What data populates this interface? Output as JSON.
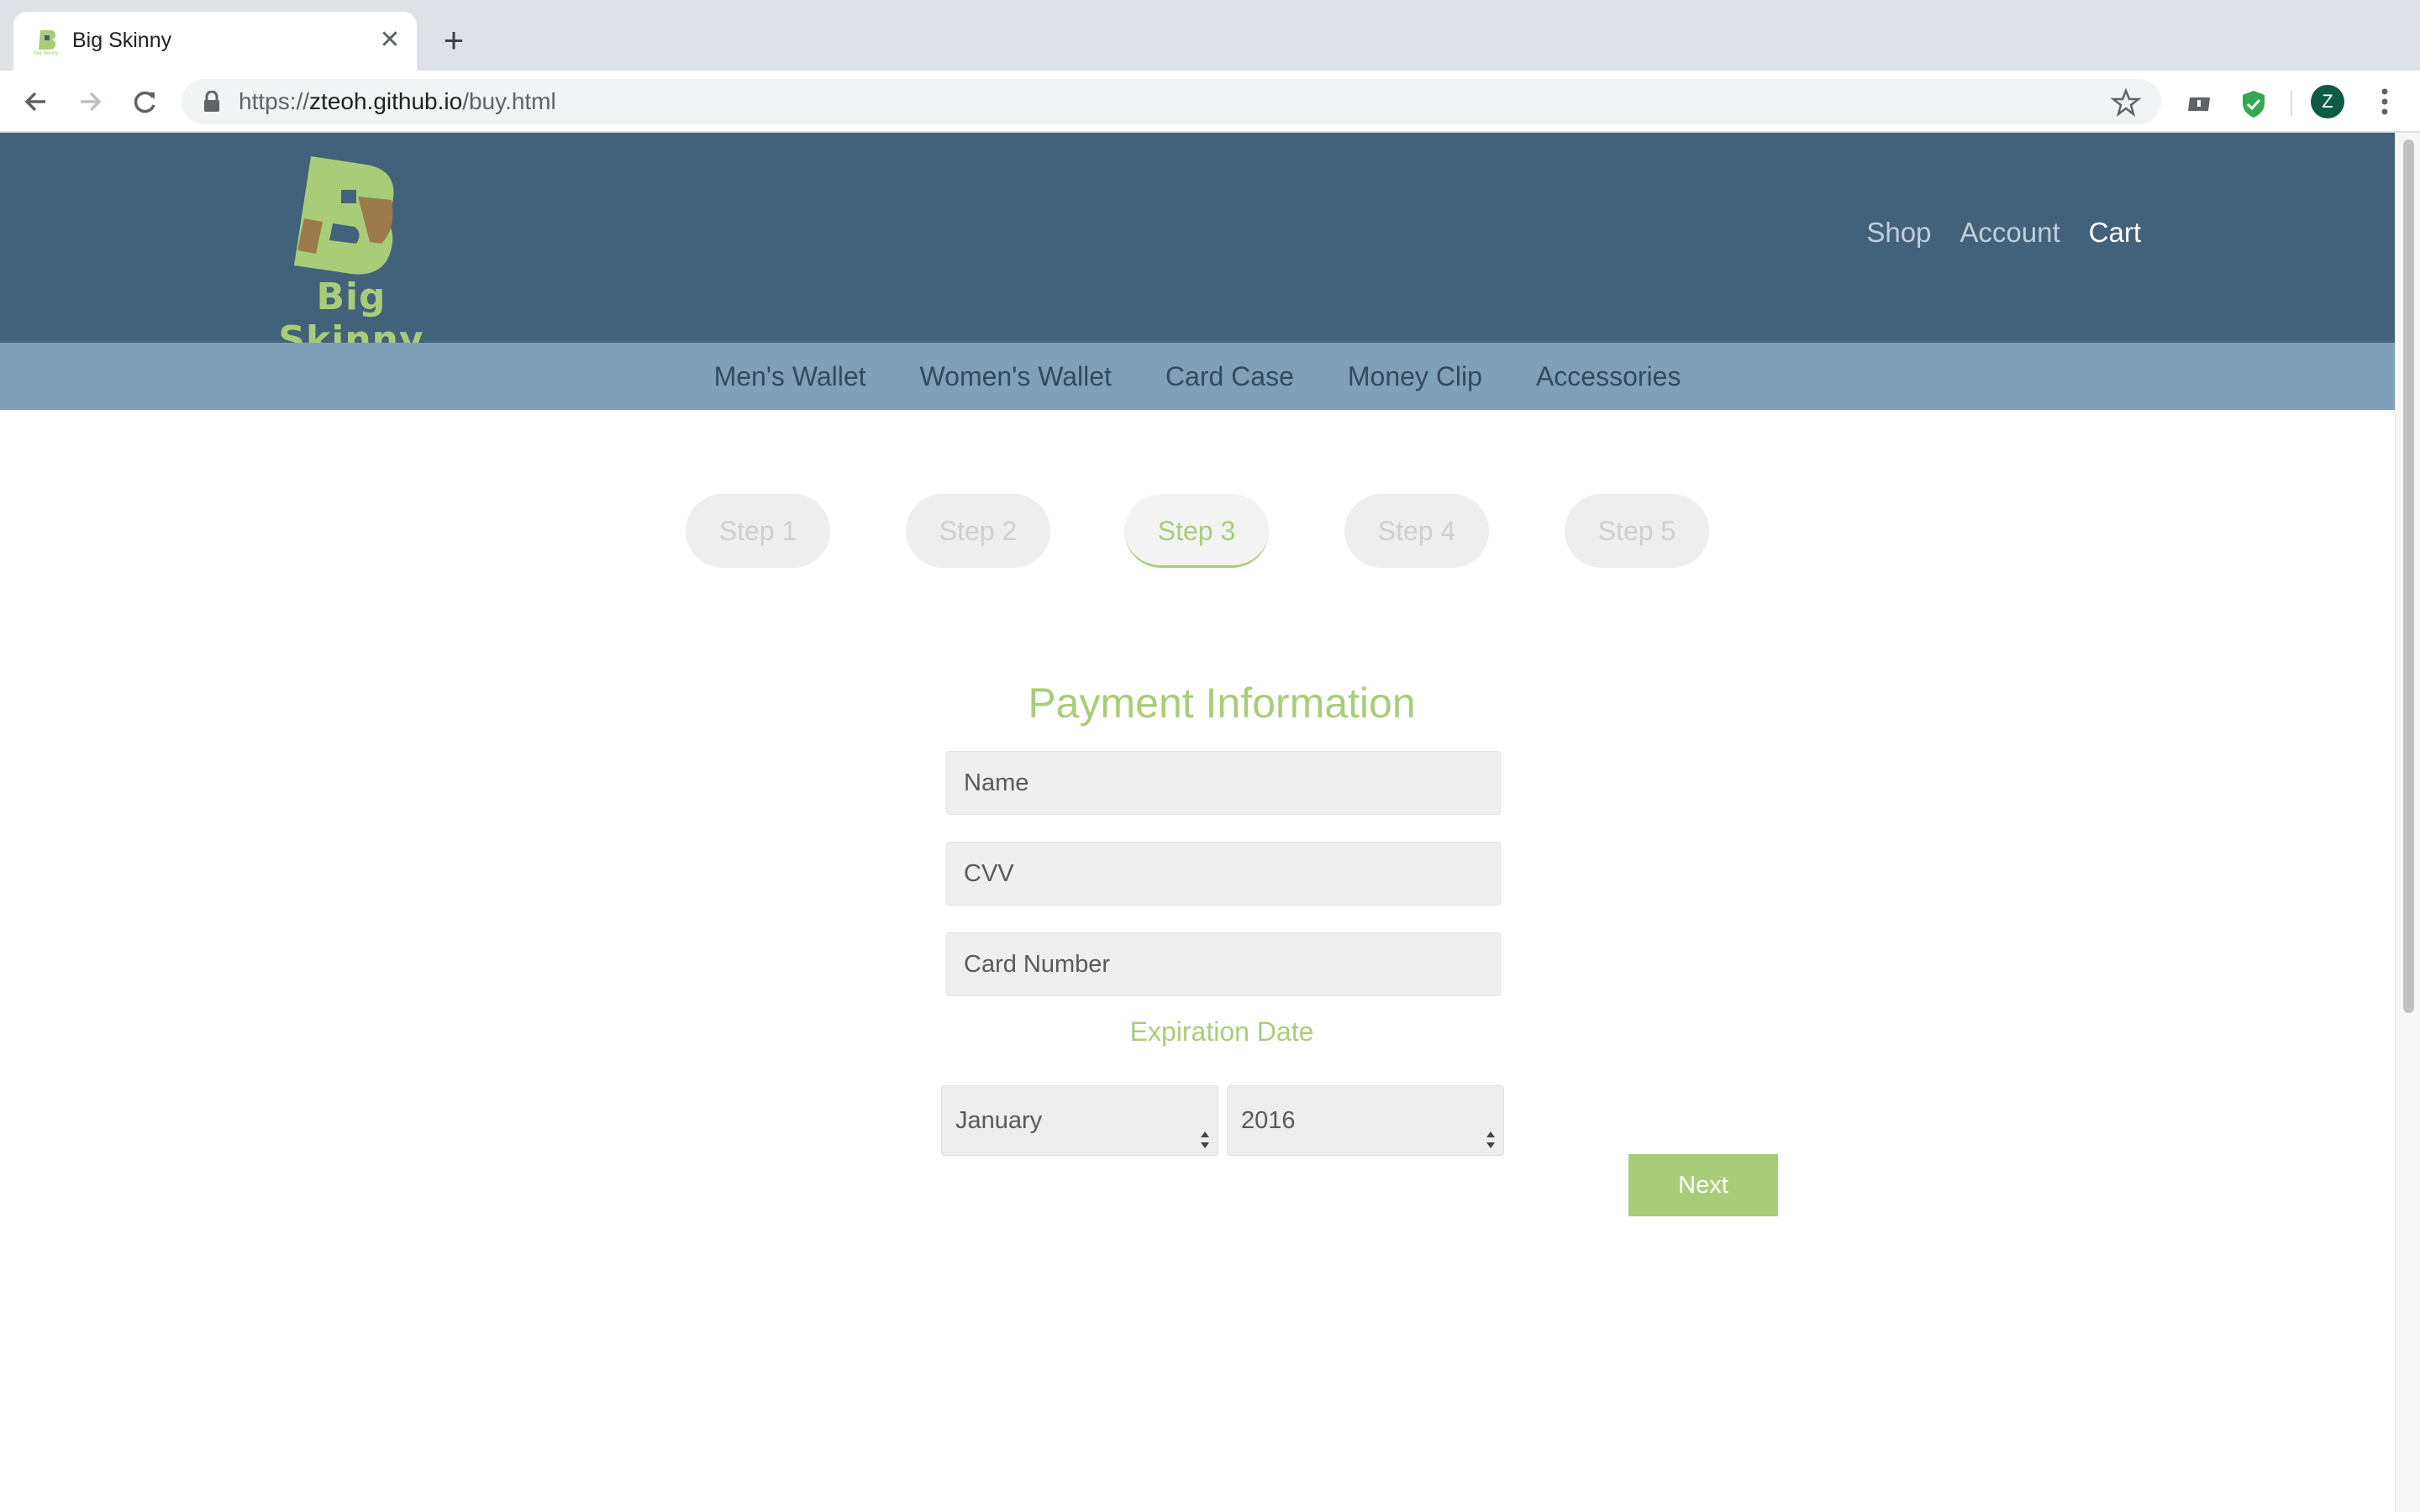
{
  "browser": {
    "tab_title": "Big Skinny",
    "url_prefix": "https://",
    "url_host": "zteoh.github.io",
    "url_path": "/buy.html",
    "avatar_letter": "Z"
  },
  "header": {
    "logo_text": "Big Skinny",
    "nav": [
      "Shop",
      "Account",
      "Cart"
    ],
    "active_nav": "Cart"
  },
  "categories": [
    "Men's Wallet",
    "Women's Wallet",
    "Card Case",
    "Money Clip",
    "Accessories"
  ],
  "steps": [
    "Step 1",
    "Step 2",
    "Step 3",
    "Step 4",
    "Step 5"
  ],
  "active_step": "Step 3",
  "form": {
    "title": "Payment Information",
    "name_placeholder": "Name",
    "cvv_placeholder": "CVV",
    "card_placeholder": "Card Number",
    "expiration_label": "Expiration Date",
    "month_value": "January",
    "year_value": "2016",
    "next_label": "Next"
  },
  "colors": {
    "header_bg": "#42617b",
    "category_bg": "#7fa0b8",
    "accent_green": "#a8cd79"
  }
}
